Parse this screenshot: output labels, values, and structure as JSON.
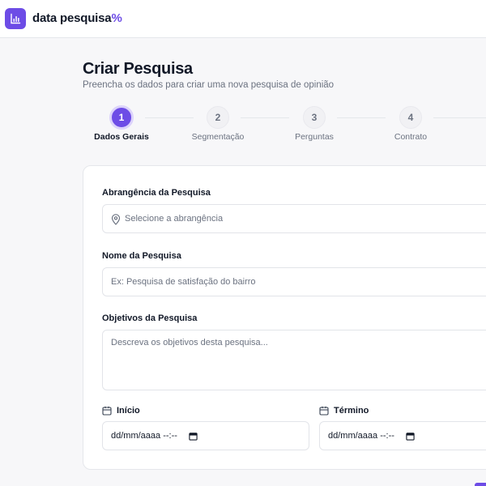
{
  "header": {
    "brand_text": "data pesquisa",
    "brand_suffix": "%",
    "logo_icon": "bar-chart-icon",
    "accent": "#6d4ce6"
  },
  "page": {
    "title": "Criar Pesquisa",
    "subtitle": "Preencha os dados para criar uma nova pesquisa de opinião"
  },
  "steps": [
    {
      "number": "1",
      "label": "Dados Gerais",
      "active": true
    },
    {
      "number": "2",
      "label": "Segmentação",
      "active": false
    },
    {
      "number": "3",
      "label": "Perguntas",
      "active": false
    },
    {
      "number": "4",
      "label": "Contrato",
      "active": false
    }
  ],
  "form": {
    "scope": {
      "label": "Abrangência da Pesquisa",
      "placeholder": "Selecione a abrangência",
      "icon": "map-pin-icon"
    },
    "name": {
      "label": "Nome da Pesquisa",
      "placeholder": "Ex: Pesquisa de satisfação do bairro"
    },
    "objectives": {
      "label": "Objetivos da Pesquisa",
      "placeholder": "Descreva os objetivos desta pesquisa..."
    },
    "start": {
      "label": "Início",
      "value": "dd/mm/aaaa --:--",
      "icon": "calendar-icon"
    },
    "end": {
      "label": "Término",
      "value": "dd/mm/aaaa --:--",
      "icon": "calendar-icon"
    }
  }
}
